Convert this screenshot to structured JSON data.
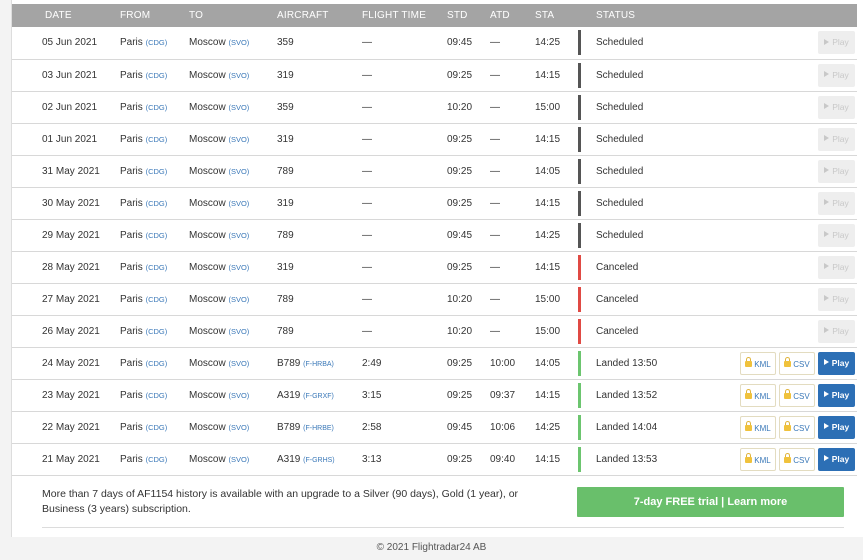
{
  "columns": {
    "date": "DATE",
    "from": "FROM",
    "to": "TO",
    "aircraft": "AIRCRAFT",
    "flight_time": "FLIGHT TIME",
    "std": "STD",
    "atd": "ATD",
    "sta": "STA",
    "status": "STATUS"
  },
  "status_colors": {
    "scheduled": "#555555",
    "canceled": "#e04a44",
    "landed": "#6cc56f"
  },
  "buttons": {
    "play": "Play",
    "kml": "KML",
    "csv": "CSV"
  },
  "flights": [
    {
      "date": "05 Jun 2021",
      "from": "Paris",
      "from_code": "(CDG)",
      "to": "Moscow",
      "to_code": "(SVO)",
      "aircraft": "359",
      "reg": "",
      "flight_time": "—",
      "std": "09:45",
      "atd": "—",
      "sta": "14:25",
      "status": "Scheduled",
      "status_type": "scheduled",
      "playable": false
    },
    {
      "date": "03 Jun 2021",
      "from": "Paris",
      "from_code": "(CDG)",
      "to": "Moscow",
      "to_code": "(SVO)",
      "aircraft": "319",
      "reg": "",
      "flight_time": "—",
      "std": "09:25",
      "atd": "—",
      "sta": "14:15",
      "status": "Scheduled",
      "status_type": "scheduled",
      "playable": false
    },
    {
      "date": "02 Jun 2021",
      "from": "Paris",
      "from_code": "(CDG)",
      "to": "Moscow",
      "to_code": "(SVO)",
      "aircraft": "359",
      "reg": "",
      "flight_time": "—",
      "std": "10:20",
      "atd": "—",
      "sta": "15:00",
      "status": "Scheduled",
      "status_type": "scheduled",
      "playable": false
    },
    {
      "date": "01 Jun 2021",
      "from": "Paris",
      "from_code": "(CDG)",
      "to": "Moscow",
      "to_code": "(SVO)",
      "aircraft": "319",
      "reg": "",
      "flight_time": "—",
      "std": "09:25",
      "atd": "—",
      "sta": "14:15",
      "status": "Scheduled",
      "status_type": "scheduled",
      "playable": false
    },
    {
      "date": "31 May 2021",
      "from": "Paris",
      "from_code": "(CDG)",
      "to": "Moscow",
      "to_code": "(SVO)",
      "aircraft": "789",
      "reg": "",
      "flight_time": "—",
      "std": "09:25",
      "atd": "—",
      "sta": "14:05",
      "status": "Scheduled",
      "status_type": "scheduled",
      "playable": false
    },
    {
      "date": "30 May 2021",
      "from": "Paris",
      "from_code": "(CDG)",
      "to": "Moscow",
      "to_code": "(SVO)",
      "aircraft": "319",
      "reg": "",
      "flight_time": "—",
      "std": "09:25",
      "atd": "—",
      "sta": "14:15",
      "status": "Scheduled",
      "status_type": "scheduled",
      "playable": false
    },
    {
      "date": "29 May 2021",
      "from": "Paris",
      "from_code": "(CDG)",
      "to": "Moscow",
      "to_code": "(SVO)",
      "aircraft": "789",
      "reg": "",
      "flight_time": "—",
      "std": "09:45",
      "atd": "—",
      "sta": "14:25",
      "status": "Scheduled",
      "status_type": "scheduled",
      "playable": false
    },
    {
      "date": "28 May 2021",
      "from": "Paris",
      "from_code": "(CDG)",
      "to": "Moscow",
      "to_code": "(SVO)",
      "aircraft": "319",
      "reg": "",
      "flight_time": "—",
      "std": "09:25",
      "atd": "—",
      "sta": "14:15",
      "status": "Canceled",
      "status_type": "canceled",
      "playable": false
    },
    {
      "date": "27 May 2021",
      "from": "Paris",
      "from_code": "(CDG)",
      "to": "Moscow",
      "to_code": "(SVO)",
      "aircraft": "789",
      "reg": "",
      "flight_time": "—",
      "std": "10:20",
      "atd": "—",
      "sta": "15:00",
      "status": "Canceled",
      "status_type": "canceled",
      "playable": false
    },
    {
      "date": "26 May 2021",
      "from": "Paris",
      "from_code": "(CDG)",
      "to": "Moscow",
      "to_code": "(SVO)",
      "aircraft": "789",
      "reg": "",
      "flight_time": "—",
      "std": "10:20",
      "atd": "—",
      "sta": "15:00",
      "status": "Canceled",
      "status_type": "canceled",
      "playable": false
    },
    {
      "date": "24 May 2021",
      "from": "Paris",
      "from_code": "(CDG)",
      "to": "Moscow",
      "to_code": "(SVO)",
      "aircraft": "B789",
      "reg": "(F-HRBA)",
      "flight_time": "2:49",
      "std": "09:25",
      "atd": "10:00",
      "sta": "14:05",
      "status": "Landed 13:50",
      "status_type": "landed",
      "playable": true
    },
    {
      "date": "23 May 2021",
      "from": "Paris",
      "from_code": "(CDG)",
      "to": "Moscow",
      "to_code": "(SVO)",
      "aircraft": "A319",
      "reg": "(F-GRXF)",
      "flight_time": "3:15",
      "std": "09:25",
      "atd": "09:37",
      "sta": "14:15",
      "status": "Landed 13:52",
      "status_type": "landed",
      "playable": true
    },
    {
      "date": "22 May 2021",
      "from": "Paris",
      "from_code": "(CDG)",
      "to": "Moscow",
      "to_code": "(SVO)",
      "aircraft": "B789",
      "reg": "(F-HRBE)",
      "flight_time": "2:58",
      "std": "09:45",
      "atd": "10:06",
      "sta": "14:25",
      "status": "Landed 14:04",
      "status_type": "landed",
      "playable": true
    },
    {
      "date": "21 May 2021",
      "from": "Paris",
      "from_code": "(CDG)",
      "to": "Moscow",
      "to_code": "(SVO)",
      "aircraft": "A319",
      "reg": "(F-GRHS)",
      "flight_time": "3:13",
      "std": "09:25",
      "atd": "09:40",
      "sta": "14:15",
      "status": "Landed 13:53",
      "status_type": "landed",
      "playable": true
    }
  ],
  "upgrade_text": "More than 7 days of AF1154 history is available with an upgrade to a Silver (90 days), Gold (1 year), or Business (3 years) subscription.",
  "trial_button": "7-day FREE trial | Learn more",
  "copyright": "© 2021 Flightradar24 AB"
}
